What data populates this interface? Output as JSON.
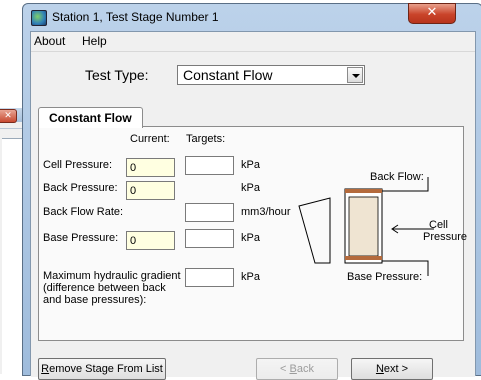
{
  "window": {
    "title": "Station 1, Test Stage Number 1",
    "close_glyph": "✕"
  },
  "menu": [
    "About",
    "Help"
  ],
  "test_type": {
    "label": "Test Type:",
    "value": "Constant Flow"
  },
  "tab": {
    "label": "Constant Flow"
  },
  "columns": {
    "current": "Current:",
    "targets": "Targets:"
  },
  "rows": {
    "cell_pressure": {
      "label": "Cell Pressure:",
      "current": "0",
      "unit": "kPa"
    },
    "back_pressure": {
      "label": "Back Pressure:",
      "current": "0",
      "unit": "kPa"
    },
    "back_flow_rate": {
      "label": "Back Flow Rate:",
      "unit": "mm3/hour"
    },
    "base_pressure": {
      "label": "Base Pressure:",
      "current": "0",
      "unit": "kPa"
    },
    "max_gradient": {
      "label_lines": [
        "Maximum hydraulic gradient",
        "(difference between back",
        "and base pressures):"
      ],
      "unit": "kPa"
    }
  },
  "diagram": {
    "back_flow": "Back Flow:",
    "cell": "Cell",
    "pressure": "Pressure",
    "base_pressure": "Base Pressure:"
  },
  "buttons": {
    "remove": {
      "accel": "R",
      "rest": "emove Stage From List"
    },
    "back": {
      "pre": "< ",
      "accel": "B",
      "rest": "ack"
    },
    "next": {
      "accel": "N",
      "rest": "ext >"
    }
  }
}
